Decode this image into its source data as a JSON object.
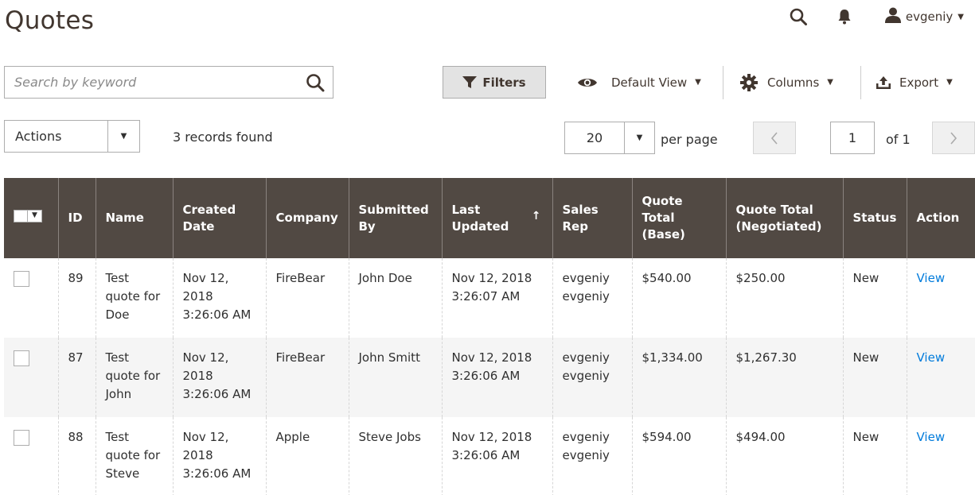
{
  "page": {
    "title": "Quotes"
  },
  "header": {
    "user_name": "evgeniy"
  },
  "toolbar": {
    "search_placeholder": "Search by keyword",
    "filters_label": "Filters",
    "default_view_label": "Default View",
    "columns_label": "Columns",
    "export_label": "Export"
  },
  "toolbar2": {
    "actions_label": "Actions",
    "records_found": "3 records found",
    "per_page_value": "20",
    "per_page_label": "per page",
    "page_value": "1",
    "page_of": "of 1"
  },
  "colors": {
    "header_bg": "#514943",
    "link": "#007bdb",
    "row_alt": "#f5f5f5"
  },
  "table": {
    "columns": {
      "id": "ID",
      "name": "Name",
      "created": "Created Date",
      "company": "Company",
      "submitted": "Submitted By",
      "updated": "Last Updated",
      "sales_rep": "Sales Rep",
      "total_base": "Quote Total (Base)",
      "total_neg": "Quote Total (Negotiated)",
      "status": "Status",
      "action": "Action"
    },
    "sort_indicator": "↑",
    "rows": [
      {
        "id": "89",
        "name": "Test quote for Doe",
        "created": "Nov 12, 2018 3:26:06 AM",
        "company": "FireBear",
        "submitted": "John Doe",
        "updated": "Nov 12, 2018 3:26:07 AM",
        "sales_rep": "evgeniy evgeniy",
        "total_base": "$540.00",
        "total_neg": "$250.00",
        "status": "New",
        "action": "View"
      },
      {
        "id": "87",
        "name": "Test quote for John",
        "created": "Nov 12, 2018 3:26:06 AM",
        "company": "FireBear",
        "submitted": "John Smitt",
        "updated": "Nov 12, 2018 3:26:06 AM",
        "sales_rep": "evgeniy evgeniy",
        "total_base": "$1,334.00",
        "total_neg": "$1,267.30",
        "status": "New",
        "action": "View"
      },
      {
        "id": "88",
        "name": "Test quote for Steve",
        "created": "Nov 12, 2018 3:26:06 AM",
        "company": "Apple",
        "submitted": "Steve Jobs",
        "updated": "Nov 12, 2018 3:26:06 AM",
        "sales_rep": "evgeniy evgeniy",
        "total_base": "$594.00",
        "total_neg": "$494.00",
        "status": "New",
        "action": "View"
      }
    ]
  }
}
